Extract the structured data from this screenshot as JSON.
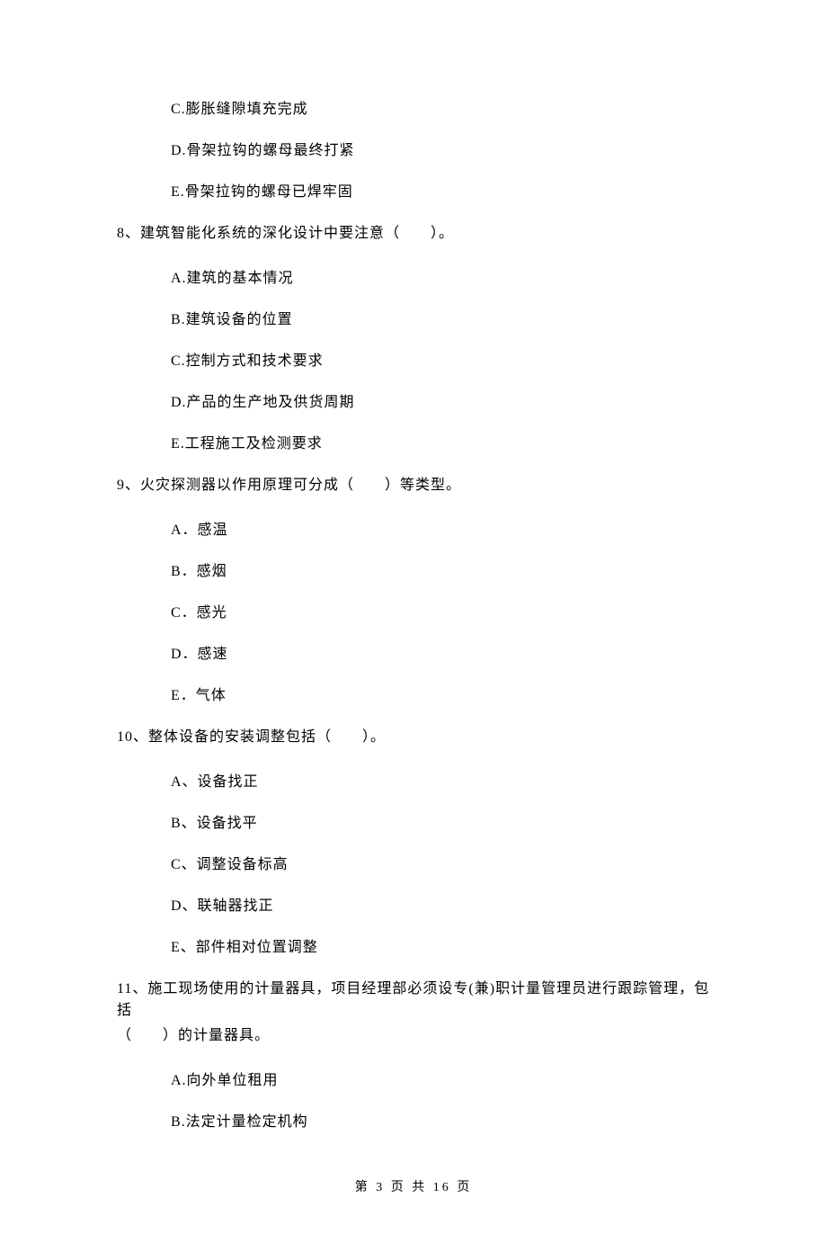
{
  "options_top": [
    "C.膨胀缝隙填充完成",
    "D.骨架拉钩的螺母最终打紧",
    "E.骨架拉钩的螺母已焊牢固"
  ],
  "q8": {
    "stem": "8、建筑智能化系统的深化设计中要注意（　　）。",
    "options": [
      "A.建筑的基本情况",
      "B.建筑设备的位置",
      "C.控制方式和技术要求",
      "D.产品的生产地及供货周期",
      "E.工程施工及检测要求"
    ]
  },
  "q9": {
    "stem": "9、火灾探测器以作用原理可分成（　　）等类型。",
    "options": [
      "A．感温",
      "B．感烟",
      "C．感光",
      "D．感速",
      "E．气体"
    ]
  },
  "q10": {
    "stem": "10、整体设备的安装调整包括（　　）。",
    "options": [
      "A、设备找正",
      "B、设备找平",
      "C、调整设备标高",
      "D、联轴器找正",
      "E、部件相对位置调整"
    ]
  },
  "q11": {
    "stem_line1": "11、施工现场使用的计量器具，项目经理部必须设专(兼)职计量管理员进行跟踪管理，包括",
    "stem_line2": "（　　）的计量器具。",
    "options": [
      "A.向外单位租用",
      "B.法定计量检定机构"
    ]
  },
  "footer": "第 3 页 共 16 页"
}
